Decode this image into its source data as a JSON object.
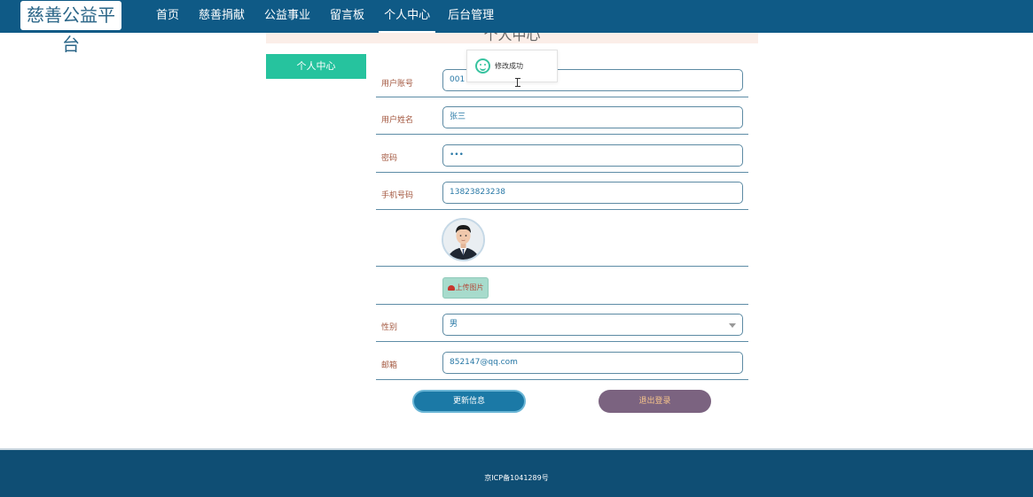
{
  "brand": {
    "logo_text": "慈善公益平台"
  },
  "nav": {
    "items": [
      "首页",
      "慈善捐献",
      "公益事业",
      "留言板",
      "个人中心",
      "后台管理"
    ],
    "active": "个人中心"
  },
  "page": {
    "title": "个人中心"
  },
  "sidebar": {
    "items": [
      {
        "label": "个人中心"
      }
    ]
  },
  "form": {
    "account": {
      "label": "用户账号",
      "value": "001"
    },
    "name": {
      "label": "用户姓名",
      "value": "张三"
    },
    "password": {
      "label": "密码",
      "value": "•••"
    },
    "phone": {
      "label": "手机号码",
      "value": "13823823238"
    },
    "upload": {
      "label": "上传图片",
      "icon": "upload-cloud-icon"
    },
    "gender": {
      "label": "性别",
      "value": "男"
    },
    "email": {
      "label": "邮箱",
      "value": "852147@qq.com"
    }
  },
  "actions": {
    "update_label": "更新信息",
    "logout_label": "退出登录"
  },
  "toast": {
    "message": "修改成功",
    "icon": "smile-icon"
  },
  "footer": {
    "icp": "京ICP备1041289号"
  },
  "colors": {
    "nav_bg": "#0f5a86",
    "sidebar_active": "#26c39e",
    "update_button": "#1b79a6",
    "logout_button": "#7b6380",
    "footer_bg": "#0f4e74"
  }
}
